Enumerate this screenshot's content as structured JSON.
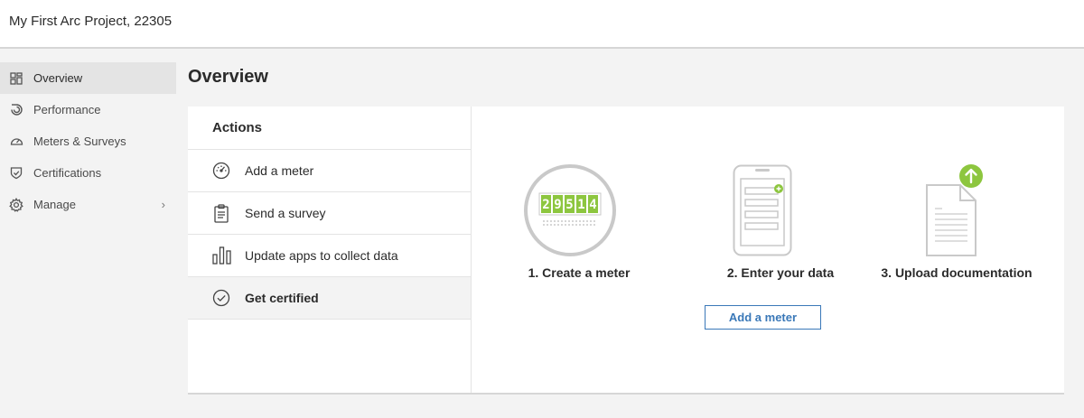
{
  "header": {
    "project_title": "My First Arc Project, 22305"
  },
  "sidebar": {
    "items": [
      {
        "label": "Overview",
        "icon": "dashboard-icon",
        "active": true
      },
      {
        "label": "Performance",
        "icon": "performance-icon"
      },
      {
        "label": "Meters & Surveys",
        "icon": "gauge-icon"
      },
      {
        "label": "Certifications",
        "icon": "shield-check-icon"
      },
      {
        "label": "Manage",
        "icon": "gear-icon",
        "chevron": "›"
      }
    ]
  },
  "main": {
    "title": "Overview",
    "actions": {
      "heading": "Actions",
      "items": [
        {
          "label": "Add a meter",
          "icon": "speedometer-icon"
        },
        {
          "label": "Send a survey",
          "icon": "clipboard-icon"
        },
        {
          "label": "Update apps to collect data",
          "icon": "bar-chart-icon"
        },
        {
          "label": "Get certified",
          "icon": "check-circle-icon",
          "active": true
        }
      ]
    },
    "steps": [
      {
        "label": "1. Create a meter",
        "icon": "meter-counter-icon",
        "digits": [
          "2",
          "9",
          "5",
          "1",
          "4"
        ]
      },
      {
        "label": "2. Enter your data",
        "icon": "phone-form-icon"
      },
      {
        "label": "3. Upload documentation",
        "icon": "document-upload-icon"
      }
    ],
    "add_meter_button": "Add a meter"
  },
  "colors": {
    "accent_green": "#8dc63f",
    "link_blue": "#3a78b8",
    "icon_gray": "#bdbdbd"
  }
}
